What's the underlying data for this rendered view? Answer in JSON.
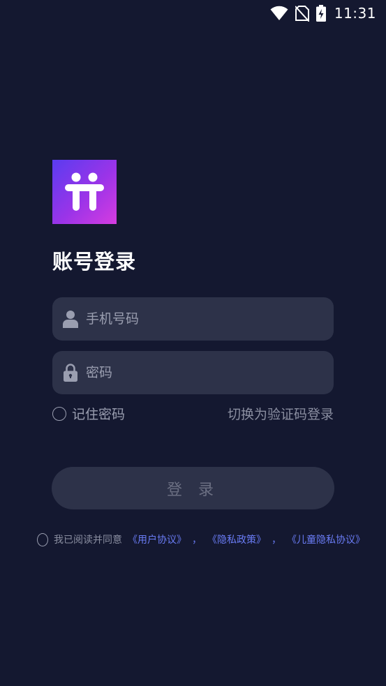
{
  "status_bar": {
    "time": "11:31",
    "icons": [
      "wifi-icon",
      "no-sim-icon",
      "battery-charging-icon"
    ]
  },
  "logo": {
    "icon": "app-logo-icon",
    "colors": [
      "#5a3cf0",
      "#d63ce0"
    ]
  },
  "page_title": "账号登录",
  "phone_field": {
    "placeholder": "手机号码",
    "value": "",
    "icon": "user-icon"
  },
  "password_field": {
    "placeholder": "密码",
    "value": "",
    "icon": "lock-icon"
  },
  "remember": {
    "label": "记住密码",
    "checked": false
  },
  "switch_login": {
    "label": "切换为验证码登录"
  },
  "login_button": {
    "label": "登 录"
  },
  "agreement": {
    "prefix": "我已阅读并同意",
    "user_agreement": "《用户协议》",
    "sep1": "，",
    "privacy_policy": "《隐私政策》",
    "sep2": "，",
    "child_privacy": "《儿童隐私协议》",
    "checked": false
  },
  "colors": {
    "background": "#141830",
    "field": "#2d3249",
    "link": "#6a7cf5",
    "muted_text": "#9a9eb0"
  }
}
